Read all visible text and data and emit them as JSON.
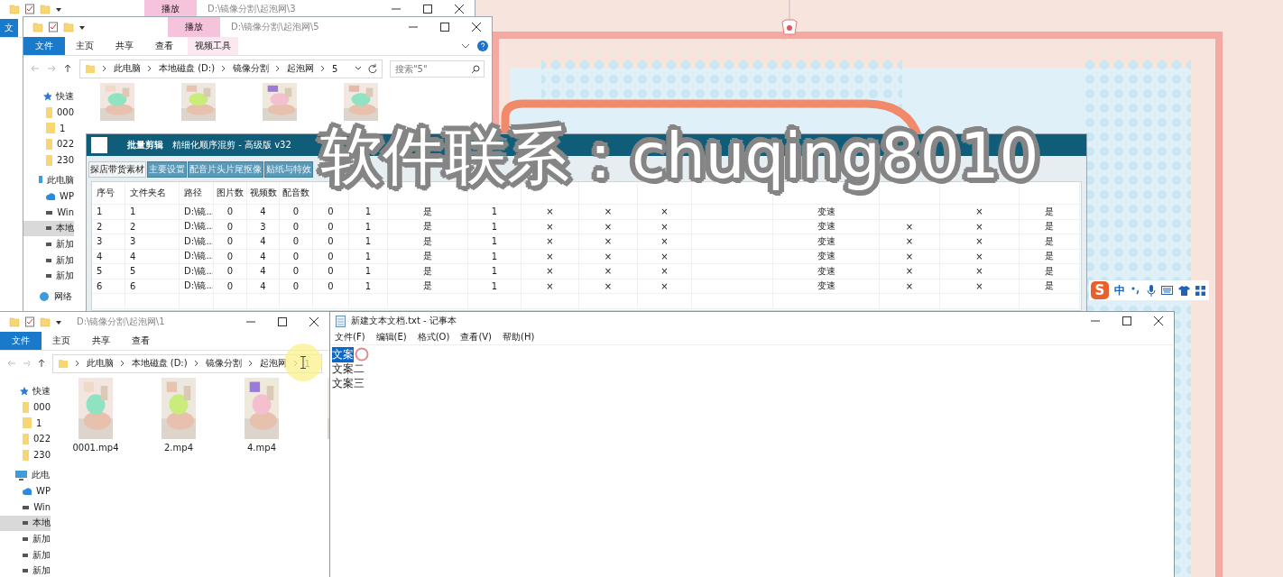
{
  "explorers": [
    {
      "title_path": "D:\\镜像分割\\起泡网\\3",
      "context_tab": "播放",
      "ribbon_tabs": [
        {
          "label": "文",
          "selected": true
        }
      ]
    },
    {
      "title_path": "D:\\镜像分割\\起泡网\\5",
      "context_tab": "播放",
      "context_group": "视频工具",
      "help": true,
      "ribbon_tabs": [
        {
          "label": "文件",
          "selected": true
        },
        {
          "label": "主页",
          "selected": false
        },
        {
          "label": "共享",
          "selected": false
        },
        {
          "label": "查看",
          "selected": false
        }
      ],
      "address": [
        "此电脑",
        "本地磁盘 (D:)",
        "镜像分割",
        "起泡网",
        "5"
      ],
      "search_placeholder": "搜索\"5\"",
      "nav_items": [
        {
          "label": "快速",
          "kind": "star",
          "selected": false
        },
        {
          "label": "000",
          "kind": "folder",
          "selected": false
        },
        {
          "label": "1",
          "kind": "folder",
          "selected": false
        },
        {
          "label": "022",
          "kind": "folder",
          "selected": false
        },
        {
          "label": "230",
          "kind": "folder",
          "selected": false
        },
        {
          "label": "此电脑",
          "kind": "pc",
          "selected": false
        },
        {
          "label": "WP",
          "kind": "cloud",
          "selected": false
        },
        {
          "label": "Win",
          "kind": "drive",
          "selected": false
        },
        {
          "label": "本地",
          "kind": "drive",
          "selected": true
        },
        {
          "label": "新加",
          "kind": "drive",
          "selected": false
        },
        {
          "label": "新加",
          "kind": "drive",
          "selected": false
        },
        {
          "label": "新加",
          "kind": "drive",
          "selected": false
        },
        {
          "label": "网络",
          "kind": "net",
          "selected": false
        }
      ],
      "files": [
        {
          "kind": "picture"
        },
        {
          "kind": "picture"
        },
        {
          "kind": "picture"
        },
        {
          "kind": "picture"
        }
      ]
    },
    {
      "title_path": "D:\\镜像分割\\起泡网\\1",
      "ribbon_tabs": [
        {
          "label": "文件",
          "selected": true
        },
        {
          "label": "主页",
          "selected": false
        },
        {
          "label": "共享",
          "selected": false
        },
        {
          "label": "查看",
          "selected": false
        }
      ],
      "address": [
        "此电脑",
        "本地磁盘 (D:)",
        "镜像分割",
        "起泡网",
        "1"
      ],
      "nav_items": [
        {
          "label": "快速",
          "kind": "star",
          "selected": false
        },
        {
          "label": "000",
          "kind": "folder",
          "selected": false
        },
        {
          "label": "1",
          "kind": "folder",
          "selected": false
        },
        {
          "label": "022",
          "kind": "folder",
          "selected": false
        },
        {
          "label": "230",
          "kind": "folder",
          "selected": false
        },
        {
          "label": "此电",
          "kind": "pc",
          "selected": false
        },
        {
          "label": "WP",
          "kind": "cloud",
          "selected": false
        },
        {
          "label": "Win",
          "kind": "drive",
          "selected": false
        },
        {
          "label": "本地",
          "kind": "drive",
          "selected": true
        },
        {
          "label": "新加",
          "kind": "drive",
          "selected": false
        },
        {
          "label": "新加",
          "kind": "drive",
          "selected": false
        },
        {
          "label": "新加",
          "kind": "drive",
          "selected": false
        }
      ],
      "files": [
        {
          "name": "0001.mp4",
          "kind": "picture"
        },
        {
          "name": "2.mp4",
          "kind": "picture"
        },
        {
          "name": "4.mp4",
          "kind": "picture"
        },
        {
          "kind": "picture"
        }
      ]
    }
  ],
  "mix_app": {
    "title": "批量剪辑",
    "subtitle": "精细化顺序混剪 - 高级版  v32",
    "tabs": [
      {
        "label": "探店带货素材",
        "selected": true
      },
      {
        "label": "主要设置",
        "selected": false
      },
      {
        "label": "配音片头片尾抠像",
        "selected": false
      },
      {
        "label": "贴纸与特效",
        "selected": false
      }
    ],
    "table": {
      "columns": [
        "序号",
        "文件夹名",
        "路径",
        "图片数",
        "视频数",
        "配音数"
      ],
      "rows": [
        [
          "1",
          "1",
          "D:\\镜...",
          "0",
          "4",
          "0",
          "0",
          "1",
          "是",
          "1",
          "×",
          "×",
          "×",
          null,
          "变速",
          null,
          "×",
          "是"
        ],
        [
          "2",
          "2",
          "D:\\镜...",
          "0",
          "3",
          "0",
          "0",
          "1",
          "是",
          "1",
          "×",
          "×",
          "×",
          null,
          "变速",
          "×",
          "×",
          "是"
        ],
        [
          "3",
          "3",
          "D:\\镜...",
          "0",
          "4",
          "0",
          "0",
          "1",
          "是",
          "1",
          "×",
          "×",
          "×",
          null,
          "变速",
          "×",
          "×",
          "是"
        ],
        [
          "4",
          "4",
          "D:\\镜...",
          "0",
          "4",
          "0",
          "0",
          "1",
          "是",
          "1",
          "×",
          "×",
          "×",
          null,
          "变速",
          "×",
          "×",
          "是"
        ],
        [
          "5",
          "5",
          "D:\\镜...",
          "0",
          "4",
          "0",
          "0",
          "1",
          "是",
          "1",
          "×",
          "×",
          "×",
          null,
          "变速",
          "×",
          "×",
          "是"
        ],
        [
          "6",
          "6",
          "D:\\镜...",
          "0",
          "4",
          "0",
          "0",
          "1",
          "是",
          "1",
          "×",
          "×",
          "×",
          null,
          "变速",
          "×",
          "×",
          "是"
        ]
      ]
    }
  },
  "notepad": {
    "title": "新建文本文档.txt - 记事本",
    "menu": [
      "文件(F)",
      "编辑(E)",
      "格式(O)",
      "查看(V)",
      "帮助(H)"
    ],
    "lines": [
      {
        "text": "文案",
        "selected": true
      },
      {
        "text": "文案二",
        "selected": false
      },
      {
        "text": "文案三",
        "selected": false
      }
    ]
  },
  "ime_bar": {
    "logo": "S",
    "mode": "中"
  },
  "overlay_text": "软件联系：chuqing8010"
}
